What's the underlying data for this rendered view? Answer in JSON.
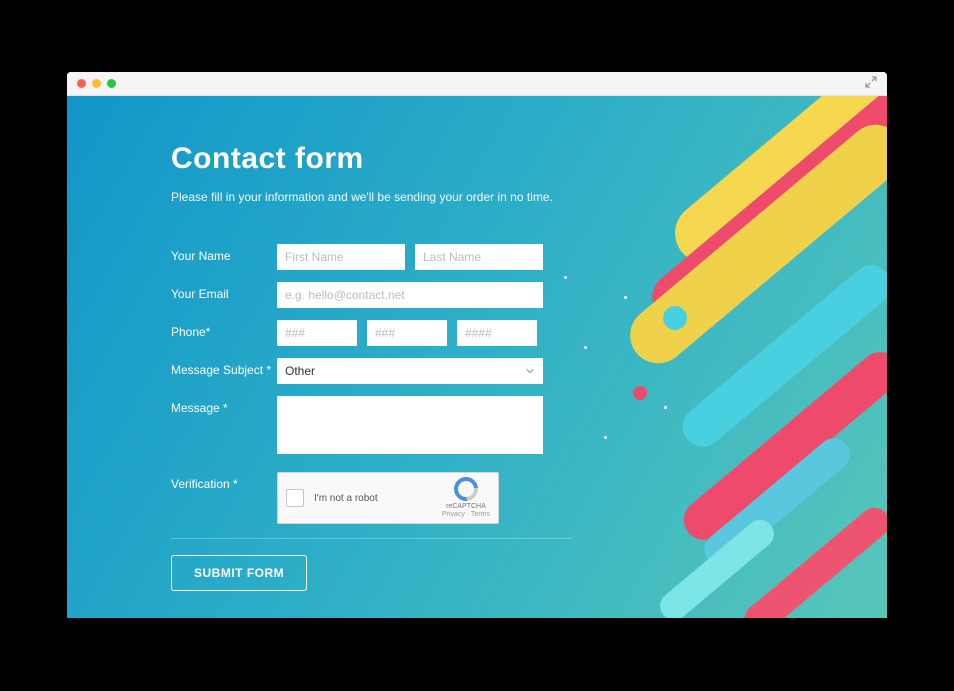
{
  "page": {
    "title": "Contact form",
    "subtitle": "Please fill in your information and we'll be sending your order in no time."
  },
  "form": {
    "labels": {
      "name": "Your Name",
      "email": "Your Email",
      "phone": "Phone*",
      "subject": "Message Subject *",
      "message": "Message *",
      "verification": "Verification *"
    },
    "placeholders": {
      "first_name": "First Name",
      "last_name": "Last Name",
      "email": "e.g. hello@contact.net",
      "phone1": "###",
      "phone2": "###",
      "phone3": "####"
    },
    "subject_selected": "Other",
    "captcha": {
      "text": "I'm not a robot",
      "brand": "reCAPTCHA",
      "links": "Privacy · Terms"
    },
    "submit_label": "SUBMIT FORM"
  }
}
